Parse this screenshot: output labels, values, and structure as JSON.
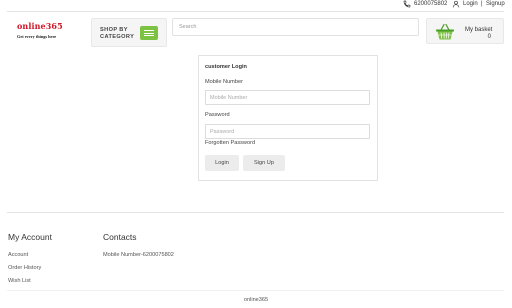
{
  "topbar": {
    "phone": "6200075802",
    "login": "Login",
    "separator": "|",
    "signup": "Signup"
  },
  "header": {
    "logo_name": "online365",
    "logo_tagline": "Get every things here",
    "shop_by_category": "SHOP BY CATEGORY",
    "search_placeholder": "Search",
    "basket_label": "My basket",
    "basket_count": "0"
  },
  "login_form": {
    "title": "customer Login",
    "mobile_label": "Mobile Number",
    "mobile_placeholder": "Mobile Number",
    "password_label": "Password",
    "password_placeholder": "Password",
    "forgot_link": "Forgotten Password",
    "login_button": "Login",
    "signup_button": "Sign Up"
  },
  "footer": {
    "account_heading": "My Account",
    "account_links": [
      "Account",
      "Order History",
      "Wish List"
    ],
    "contacts_heading": "Contacts",
    "contact_mobile": "Mobile Number-6200075802",
    "copyright": "online365"
  },
  "colors": {
    "brand_red": "#d01527",
    "accent_green": "#7dc243"
  },
  "icons": {
    "phone": "phone-icon",
    "user": "user-icon",
    "menu": "hamburger-menu-icon",
    "basket": "basket-icon"
  }
}
